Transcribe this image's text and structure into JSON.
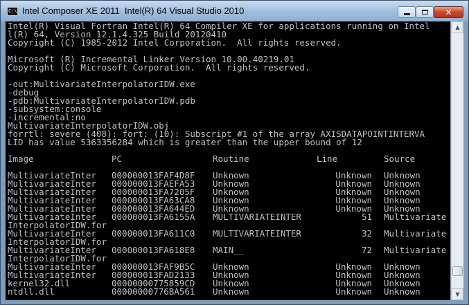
{
  "window": {
    "title": "Intel Composer XE 2011  Intel(R) 64 Visual Studio 2010",
    "icon_text": "C:\\",
    "controls": {
      "minimize": "minimize-icon",
      "maximize": "maximize-icon",
      "close": "close-icon"
    }
  },
  "console": {
    "lines": [
      "Intel(R) Visual Fortran Intel(R) 64 Compiler XE for applications running on Intel",
      "l(R) 64, Version 12.1.4.325 Build 20120410",
      "Copyright (C) 1985-2012 Intel Corporation.  All rights reserved.",
      "",
      "Microsoft (R) Incremental Linker Version 10.00.40219.01",
      "Copyright (C) Microsoft Corporation.  All rights reserved.",
      "",
      "-out:MultivariateInterpolatorIDW.exe",
      "-debug",
      "-pdb:MultivariateInterpolatorIDW.pdb",
      "-subsystem:console",
      "-incremental:no",
      "MultivariateInterpolatorIDW.obj",
      "forrtl: severe (408): fort: (10): Subscript #1 of the array AXISDATAPOINTINTERVA",
      "LID has value 5363356284 which is greater than the upper bound of 12",
      ""
    ],
    "traceback_header": [
      "Image",
      "PC",
      "Routine",
      "Line",
      "Source"
    ],
    "traceback_rows": [
      {
        "image": "MultivariateInter",
        "pc": "000000013FAF4D8F",
        "routine": "Unknown",
        "line": "Unknown",
        "source": "Unknown"
      },
      {
        "image": "MultivariateInter",
        "pc": "000000013FAEFA53",
        "routine": "Unknown",
        "line": "Unknown",
        "source": "Unknown"
      },
      {
        "image": "MultivariateInter",
        "pc": "000000013FA7205F",
        "routine": "Unknown",
        "line": "Unknown",
        "source": "Unknown"
      },
      {
        "image": "MultivariateInter",
        "pc": "000000013FA63CA8",
        "routine": "Unknown",
        "line": "Unknown",
        "source": "Unknown"
      },
      {
        "image": "MultivariateInter",
        "pc": "000000013FA644ED",
        "routine": "Unknown",
        "line": "Unknown",
        "source": "Unknown"
      },
      {
        "image": "MultivariateInter",
        "pc": "000000013FA6155A",
        "routine": "MULTIVARIATEINTER",
        "line": "51",
        "source": "Multivariate",
        "continuation": "InterpolatorIDW.for"
      },
      {
        "image": "MultivariateInter",
        "pc": "000000013FA611C0",
        "routine": "MULTIVARIATEINTER",
        "line": "32",
        "source": "Multivariate",
        "continuation": "InterpolatorIDW.for"
      },
      {
        "image": "MultivariateInter",
        "pc": "000000013FA618E8",
        "routine": "MAIN__",
        "line": "72",
        "source": "Multivariate",
        "continuation": "InterpolatorIDW.for"
      },
      {
        "image": "MultivariateInter",
        "pc": "000000013FAF9B5C",
        "routine": "Unknown",
        "line": "Unknown",
        "source": "Unknown"
      },
      {
        "image": "MultivariateInter",
        "pc": "000000013FAD2133",
        "routine": "Unknown",
        "line": "Unknown",
        "source": "Unknown"
      },
      {
        "image": "kernel32.dll",
        "pc": "00000000775859CD",
        "routine": "Unknown",
        "line": "Unknown",
        "source": "Unknown"
      },
      {
        "image": "ntdll.dll",
        "pc": "00000000776BA561",
        "routine": "Unknown",
        "line": "Unknown",
        "source": "Unknown"
      }
    ]
  },
  "scrollbar": {
    "up_icon": "scroll-up-arrow-icon",
    "down_icon": "scroll-down-arrow-icon",
    "position_fraction": 0.95
  },
  "colors": {
    "console_bg": "#000000",
    "console_text": "#c0c0c0",
    "window_frame": "#7f9dbb"
  }
}
